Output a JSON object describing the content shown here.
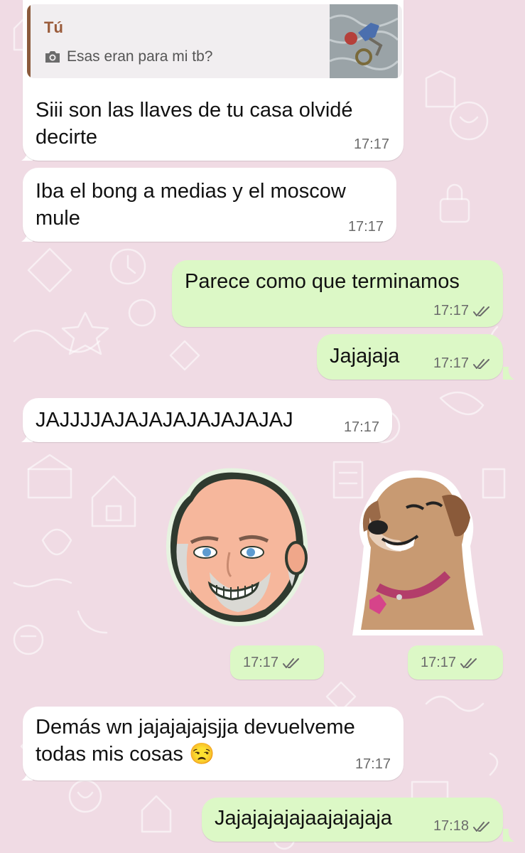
{
  "chat": {
    "messages": [
      {
        "direction": "incoming",
        "reply": {
          "sender": "Tú",
          "text": "Esas eran para mi tb?",
          "icon": "camera-icon"
        },
        "text_line1": "Siii son las llaves de tu casa olvidé",
        "text_line2": "decirte",
        "time": "17:17"
      },
      {
        "direction": "incoming",
        "text_line1": "Iba el bong a medias y el moscow",
        "text_line2": "mule",
        "time": "17:17"
      },
      {
        "direction": "outgoing",
        "text": "Parece como que terminamos",
        "time": "17:17",
        "status": "read"
      },
      {
        "direction": "outgoing",
        "text": "Jajajaja",
        "time": "17:17",
        "status": "read"
      },
      {
        "direction": "incoming",
        "text": "JAJJJJAJAJAJAJAJAJAJAJ",
        "time": "17:17"
      },
      {
        "direction": "outgoing",
        "type": "sticker",
        "sticker": "bald-man-sticker",
        "time": "17:17",
        "status": "read"
      },
      {
        "direction": "outgoing",
        "type": "sticker",
        "sticker": "laughing-dog-sticker",
        "time": "17:17",
        "status": "read"
      },
      {
        "direction": "incoming",
        "text_line1": "Demás wn jajajajajsjja devuelveme",
        "text_line2": "todas mis cosas",
        "emoji": "😒",
        "time": "17:17"
      },
      {
        "direction": "outgoing",
        "text": "Jajajajajajaajajajaja",
        "time": "17:18",
        "status": "read"
      }
    ]
  },
  "colors": {
    "background": "#f0dbe4",
    "incoming_bubble": "#ffffff",
    "outgoing_bubble": "#dcf8c6",
    "read_ticks": "#6b6b6b",
    "reply_bar": "#8b5a3c"
  }
}
